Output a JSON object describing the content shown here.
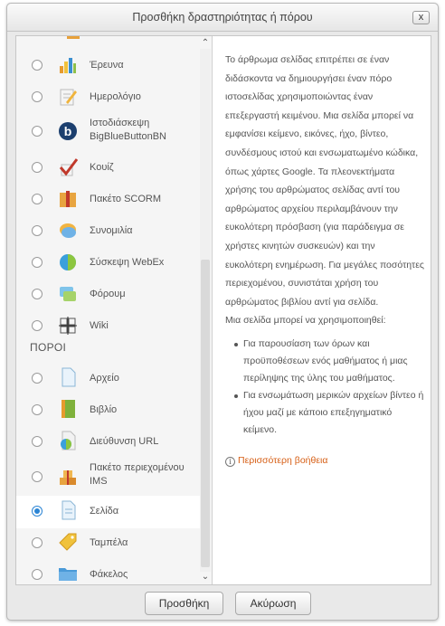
{
  "dialog": {
    "title": "Προσθήκη δραστηριότητας ή πόρου",
    "close_label": "x"
  },
  "activities": [
    {
      "label": "Έρευνα",
      "icon": "survey-chart-icon",
      "selected": false
    },
    {
      "label": "Ημερολόγιο",
      "icon": "journal-pencil-icon",
      "selected": false
    },
    {
      "label": "Ιστοδιάσκεψη BigBlueButtonBN",
      "icon": "bigbluebutton-icon",
      "selected": false
    },
    {
      "label": "Κουίζ",
      "icon": "quiz-check-icon",
      "selected": false
    },
    {
      "label": "Πακέτο SCORM",
      "icon": "scorm-package-icon",
      "selected": false
    },
    {
      "label": "Συνομιλία",
      "icon": "chat-bubble-icon",
      "selected": false
    },
    {
      "label": "Σύσκεψη WebEx",
      "icon": "webex-globe-icon",
      "selected": false
    },
    {
      "label": "Φόρουμ",
      "icon": "forum-icon",
      "selected": false
    },
    {
      "label": "Wiki",
      "icon": "wiki-icon",
      "selected": false
    }
  ],
  "resources_heading": "ΠΟΡΟΙ",
  "resources": [
    {
      "label": "Αρχείο",
      "icon": "file-icon",
      "selected": false
    },
    {
      "label": "Βιβλίο",
      "icon": "book-icon",
      "selected": false
    },
    {
      "label": "Διεύθυνση URL",
      "icon": "url-globe-icon",
      "selected": false
    },
    {
      "label": "Πακέτο περιεχομένου IMS",
      "icon": "ims-package-icon",
      "selected": false
    },
    {
      "label": "Σελίδα",
      "icon": "page-icon",
      "selected": true
    },
    {
      "label": "Ταμπέλα",
      "icon": "label-tag-icon",
      "selected": false
    },
    {
      "label": "Φάκελος",
      "icon": "folder-icon",
      "selected": false
    }
  ],
  "description": {
    "paragraph": "Το άρθρωμα σελίδας επιτρέπει σε έναν διδάσκοντα να δημιουργήσει έναν πόρο ιστοσελίδας χρησιμοποιώντας έναν επεξεργαστή κειμένου. Μια σελίδα μπορεί να εμφανίσει κείμενο, εικόνες, ήχο, βίντεο, συνδέσμους ιστού και ενσωματωμένο κώδικα, όπως χάρτες Google. Τα πλεονεκτήματα χρήσης του αρθρώματος σελίδας αντί του αρθρώματος αρχείου περιλαμβάνουν την ευκολότερη πρόσβαση (για παράδειγμα σε χρήστες κινητών συσκευών) και την ευκολότερη ενημέρωση. Για μεγάλες ποσότητες περιεχομένου, συνιστάται χρήση του αρθρώματος βιβλίου αντί για σελίδα.",
    "uses_intro": "Μια σελίδα μπορεί να χρησιμοποιηθεί:",
    "bullets": [
      "Για παρουσίαση των όρων και προϋποθέσεων ενός μαθήματος ή μιας περίληψης της ύλης του μαθήματος.",
      "Για ενσωμάτωση μερικών αρχείων βίντεο ή ήχου μαζί με κάποιο επεξηγηματικό κείμενο."
    ],
    "more_help": "Περισσότερη βοήθεια"
  },
  "buttons": {
    "add": "Προσθήκη",
    "cancel": "Ακύρωση"
  },
  "colors": {
    "accent": "#2a84d4",
    "link": "#d65e14"
  }
}
